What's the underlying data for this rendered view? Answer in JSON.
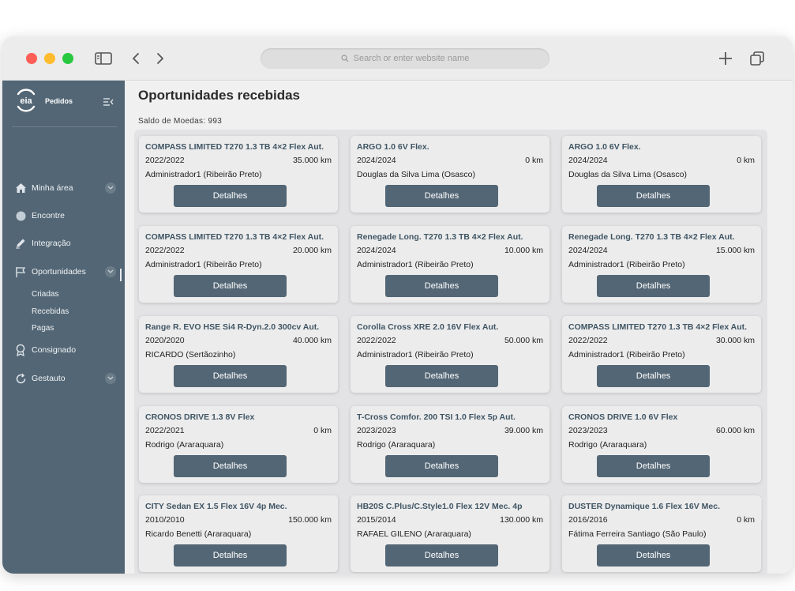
{
  "browser": {
    "address_placeholder": "Search or enter website name"
  },
  "sidebar": {
    "brand_logo_text": "eia",
    "brand": "Pedidos",
    "nav": [
      {
        "label": "Minha área"
      },
      {
        "label": "Encontre"
      },
      {
        "label": "Integração"
      },
      {
        "label": "Oportunidades"
      },
      {
        "label": "Consignado"
      },
      {
        "label": "Gestauto"
      }
    ],
    "sub_items": [
      {
        "label": "Criadas"
      },
      {
        "label": "Recebidas"
      },
      {
        "label": "Pagas"
      }
    ]
  },
  "main": {
    "title": "Oportunidades recebidas",
    "saldo": "Saldo de Moedas: 993",
    "button_label": "Detalhes",
    "cards": [
      {
        "title": "COMPASS LIMITED T270 1.3 TB 4×2 Flex Aut.",
        "year": "2022/2022",
        "km": "35.000 km",
        "owner": "Administrador1 (Ribeirão Preto)"
      },
      {
        "title": "ARGO 1.0 6V Flex.",
        "year": "2024/2024",
        "km": "0 km",
        "owner": "Douglas da Silva Lima (Osasco)"
      },
      {
        "title": "ARGO 1.0 6V Flex.",
        "year": "2024/2024",
        "km": "0 km",
        "owner": "Douglas da Silva Lima (Osasco)"
      },
      {
        "title": "COMPASS LIMITED T270 1.3 TB 4×2 Flex Aut.",
        "year": "2022/2022",
        "km": "20.000 km",
        "owner": "Administrador1 (Ribeirão Preto)"
      },
      {
        "title": "Renegade Long. T270 1.3 TB 4×2 Flex Aut.",
        "year": "2024/2024",
        "km": "10.000 km",
        "owner": "Administrador1 (Ribeirão Preto)"
      },
      {
        "title": "Renegade Long. T270 1.3 TB 4×2 Flex Aut.",
        "year": "2024/2024",
        "km": "15.000 km",
        "owner": "Administrador1 (Ribeirão Preto)"
      },
      {
        "title": "Range R. EVO HSE Si4 R-Dyn.2.0 300cv Aut.",
        "year": "2020/2020",
        "km": "40.000 km",
        "owner": "RICARDO (Sertãozinho)"
      },
      {
        "title": "Corolla Cross XRE 2.0 16V Flex Aut.",
        "year": "2022/2022",
        "km": "50.000 km",
        "owner": "Administrador1 (Ribeirão Preto)"
      },
      {
        "title": "COMPASS LIMITED T270 1.3 TB 4×2 Flex Aut.",
        "year": "2022/2022",
        "km": "30.000 km",
        "owner": "Administrador1 (Ribeirão Preto)"
      },
      {
        "title": "CRONOS DRIVE 1.3 8V Flex",
        "year": "2022/2021",
        "km": "0 km",
        "owner": "Rodrigo (Araraquara)"
      },
      {
        "title": "T-Cross Comfor. 200 TSI 1.0 Flex 5p Aut.",
        "year": "2023/2023",
        "km": "39.000 km",
        "owner": "Rodrigo (Araraquara)"
      },
      {
        "title": "CRONOS DRIVE 1.0 6V Flex",
        "year": "2023/2023",
        "km": "60.000 km",
        "owner": "Rodrigo (Araraquara)"
      },
      {
        "title": "CITY Sedan EX 1.5 Flex 16V 4p Mec.",
        "year": "2010/2010",
        "km": "150.000 km",
        "owner": "Ricardo Benetti (Araraquara)"
      },
      {
        "title": "HB20S C.Plus/C.Style1.0 Flex 12V Mec. 4p",
        "year": "2015/2014",
        "km": "130.000 km",
        "owner": "RAFAEL GILENO (Araraquara)"
      },
      {
        "title": "DUSTER Dynamique 1.6 Flex 16V Mec.",
        "year": "2016/2016",
        "km": "0 km",
        "owner": "Fátima Ferreira Santiago (São Paulo)"
      }
    ]
  },
  "colors": {
    "sidebar": "#536675",
    "button": "#536675",
    "card_title": "#3f5563"
  }
}
